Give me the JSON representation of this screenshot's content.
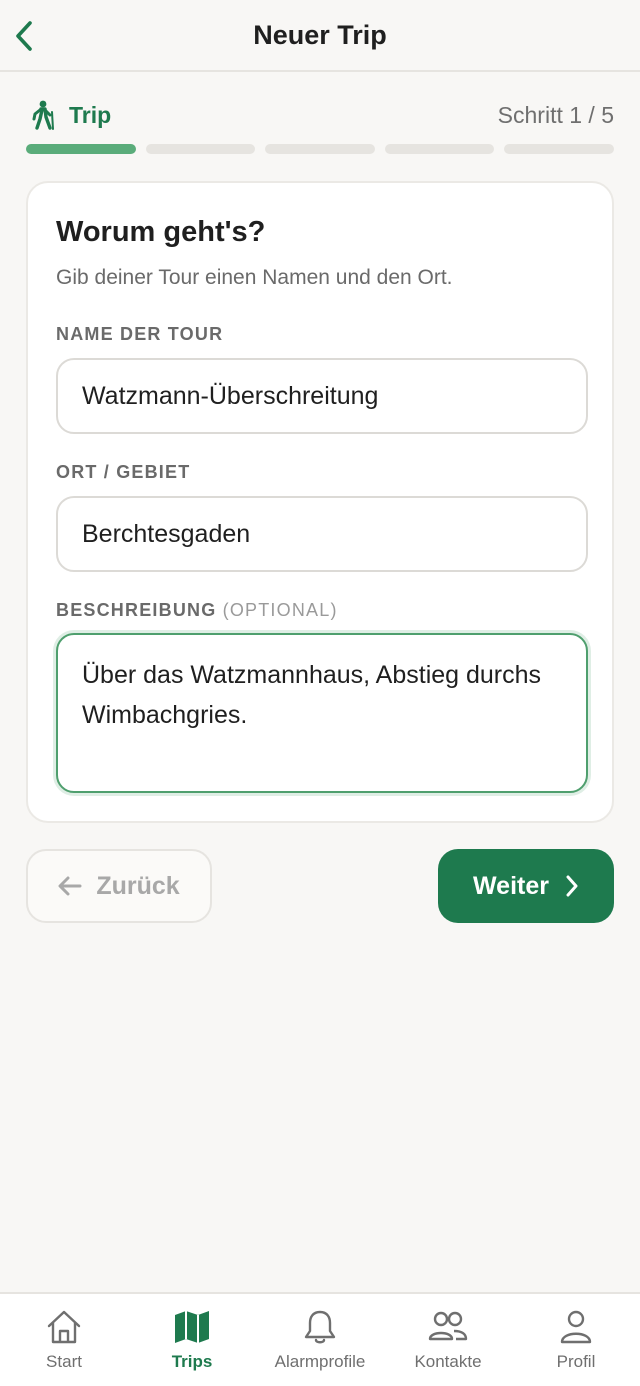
{
  "header": {
    "title": "Neuer Trip"
  },
  "stepper": {
    "label": "Trip",
    "counter": "Schritt 1 / 5",
    "current_step": 1,
    "total_steps": 5
  },
  "form": {
    "title": "Worum geht's?",
    "subtitle": "Gib deiner Tour einen Namen und den Ort.",
    "name": {
      "label": "NAME DER TOUR",
      "value": "Watzmann-Überschreitung"
    },
    "location": {
      "label": "ORT / GEBIET",
      "value": "Berchtesgaden"
    },
    "description": {
      "label": "BESCHREIBUNG",
      "optional": "(OPTIONAL)",
      "value": "Über das Watzmannhaus, Abstieg durchs Wimbachgries."
    }
  },
  "actions": {
    "back_label": "Zurück",
    "next_label": "Weiter"
  },
  "tabs": [
    {
      "label": "Start",
      "icon": "home-icon",
      "active": false
    },
    {
      "label": "Trips",
      "icon": "map-icon",
      "active": true
    },
    {
      "label": "Alarmprofile",
      "icon": "bell-icon",
      "active": false
    },
    {
      "label": "Kontakte",
      "icon": "contacts-icon",
      "active": false
    },
    {
      "label": "Profil",
      "icon": "person-icon",
      "active": false
    }
  ],
  "colors": {
    "accent": "#1e7a4e",
    "progress_active": "#5aac7a",
    "background": "#f8f7f5"
  }
}
